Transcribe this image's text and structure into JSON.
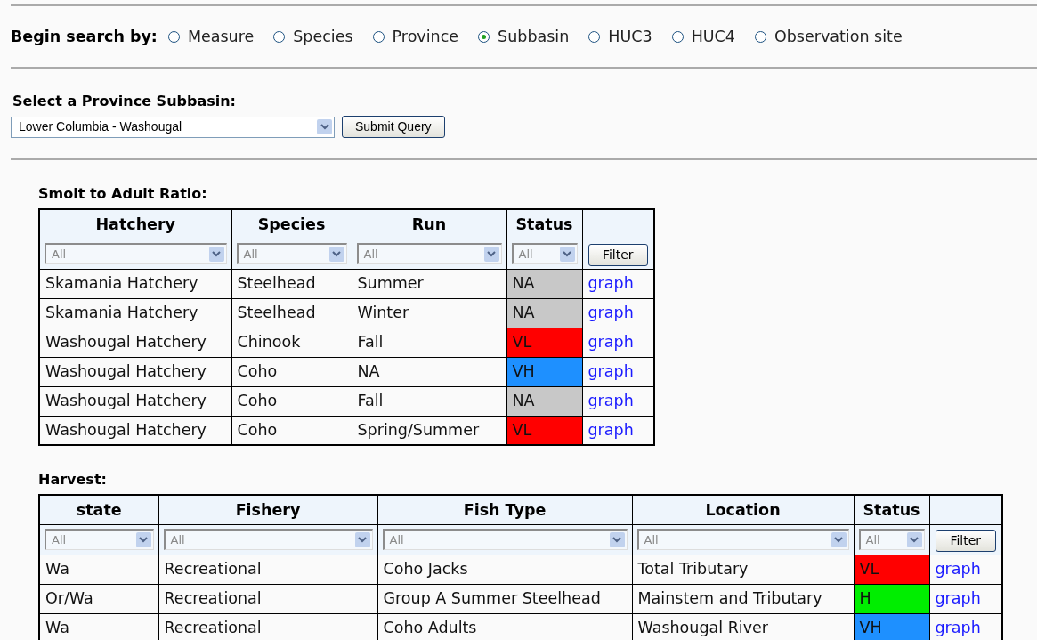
{
  "search_by": {
    "label": "Begin search by:",
    "options": [
      {
        "label": "Measure",
        "selected": false
      },
      {
        "label": "Species",
        "selected": false
      },
      {
        "label": "Province",
        "selected": false
      },
      {
        "label": "Subbasin",
        "selected": true
      },
      {
        "label": "HUC3",
        "selected": false
      },
      {
        "label": "HUC4",
        "selected": false
      },
      {
        "label": "Observation site",
        "selected": false
      }
    ]
  },
  "subbasin": {
    "label": "Select a Province Subbasin:",
    "value": "Lower Columbia - Washougal",
    "button": "Submit Query"
  },
  "tables": [
    {
      "title": "Smolt to Adult Ratio:",
      "columns": [
        "Hatchery",
        "Species",
        "Run",
        "Status",
        ""
      ],
      "filters": [
        "All",
        "All",
        "All",
        "All"
      ],
      "filter_button": "Filter",
      "rows": [
        {
          "cells": [
            "Skamania Hatchery",
            "Steelhead",
            "Summer"
          ],
          "status": "NA",
          "color": "#c8c8c8",
          "link": "graph"
        },
        {
          "cells": [
            "Skamania Hatchery",
            "Steelhead",
            "Winter"
          ],
          "status": "NA",
          "color": "#c8c8c8",
          "link": "graph"
        },
        {
          "cells": [
            "Washougal Hatchery",
            "Chinook",
            "Fall"
          ],
          "status": "VL",
          "color": "#ff0000",
          "link": "graph"
        },
        {
          "cells": [
            "Washougal Hatchery",
            "Coho",
            "NA"
          ],
          "status": "VH",
          "color": "#1e90ff",
          "link": "graph"
        },
        {
          "cells": [
            "Washougal Hatchery",
            "Coho",
            "Fall"
          ],
          "status": "NA",
          "color": "#c8c8c8",
          "link": "graph"
        },
        {
          "cells": [
            "Washougal Hatchery",
            "Coho",
            "Spring/Summer"
          ],
          "status": "VL",
          "color": "#ff0000",
          "link": "graph"
        }
      ]
    },
    {
      "title": "Harvest:",
      "columns": [
        "state",
        "Fishery",
        "Fish Type",
        "Location",
        "Status",
        ""
      ],
      "filters": [
        "All",
        "All",
        "All",
        "All",
        "All"
      ],
      "filter_button": "Filter",
      "rows": [
        {
          "cells": [
            "Wa",
            "Recreational",
            "Coho Jacks",
            "Total Tributary"
          ],
          "status": "VL",
          "color": "#ff0000",
          "link": "graph"
        },
        {
          "cells": [
            "Or/Wa",
            "Recreational",
            "Group A Summer Steelhead",
            "Mainstem and Tributary"
          ],
          "status": "H",
          "color": "#00ee00",
          "link": "graph"
        },
        {
          "cells": [
            "Wa",
            "Recreational",
            "Coho Adults",
            "Washougal River"
          ],
          "status": "VH",
          "color": "#1e90ff",
          "link": "graph"
        }
      ]
    }
  ]
}
